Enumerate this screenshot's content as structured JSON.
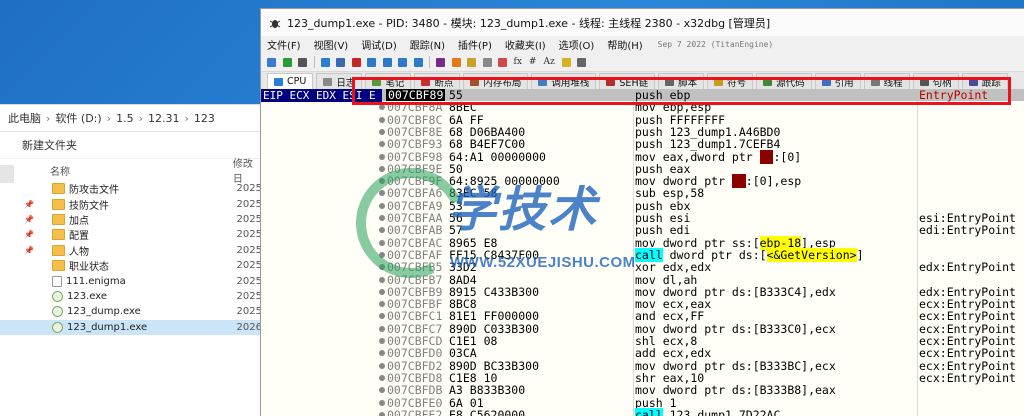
{
  "explorer": {
    "path": [
      "此电脑",
      "软件 (D:)",
      "1.5",
      "12.31",
      "123"
    ],
    "new_folder": "新建文件夹",
    "col_name": "名称",
    "col_date": "修改日",
    "items": [
      {
        "name": "防攻击文件",
        "date": "2025",
        "kind": "folder",
        "pinned": false
      },
      {
        "name": "技防文件",
        "date": "2025",
        "kind": "folder",
        "pinned": true
      },
      {
        "name": "加点",
        "date": "2025",
        "kind": "folder",
        "pinned": true
      },
      {
        "name": "配置",
        "date": "2025",
        "kind": "folder",
        "pinned": true
      },
      {
        "name": "人物",
        "date": "2025",
        "kind": "folder",
        "pinned": true
      },
      {
        "name": "职业状态",
        "date": "2025",
        "kind": "folder",
        "pinned": false
      },
      {
        "name": "111.enigma",
        "date": "2025",
        "kind": "file",
        "pinned": false
      },
      {
        "name": "123.exe",
        "date": "2025",
        "kind": "exe",
        "pinned": false
      },
      {
        "name": "123_dump.exe",
        "date": "2025",
        "kind": "exe",
        "pinned": false
      },
      {
        "name": "123_dump1.exe",
        "date": "2026",
        "kind": "exe",
        "pinned": false,
        "selected": true
      }
    ]
  },
  "dbg": {
    "title": "123_dump1.exe - PID: 3480 - 模块: 123_dump1.exe - 线程: 主线程 2380 - x32dbg [管理员]",
    "menu": [
      "文件(F)",
      "视图(V)",
      "调试(D)",
      "跟踪(N)",
      "插件(P)",
      "收藏夹(I)",
      "选项(O)",
      "帮助(H)"
    ],
    "build_info": "Sep 7 2022 (TitanEngine)",
    "toolbar_text": [
      "fx",
      "#",
      "Az"
    ],
    "tabs": [
      "CPU",
      "日志",
      "笔记",
      "断点",
      "内存布局",
      "调用堆栈",
      "SEH链",
      "脚本",
      "符号",
      "源代码",
      "引用",
      "线程",
      "句柄",
      "跟踪"
    ],
    "active_tab": "CPU",
    "regbar": "EIP ECX EDX ESI E",
    "rows": [
      {
        "addr": "007CBF89",
        "bytes": "55",
        "ins": "push ebp",
        "cmt": "EntryPoint",
        "current": true
      },
      {
        "addr": "007CBF8A",
        "bytes": "8BEC",
        "ins": "mov ebp,esp",
        "cmt": ""
      },
      {
        "addr": "007CBF8C",
        "bytes": "6A FF",
        "ins": "push FFFFFFFF",
        "cmt": ""
      },
      {
        "addr": "007CBF8E",
        "bytes": "68 D06BA400",
        "ins": "push 123_dump1.A46BD0",
        "cmt": ""
      },
      {
        "addr": "007CBF93",
        "bytes": "68 B4EF7C00",
        "ins": "push 123_dump1.7CEFB4",
        "cmt": ""
      },
      {
        "addr": "007CBF98",
        "bytes": "64:A1 00000000",
        "ins": "mov eax,dword ptr fs:[0]",
        "cmt": ""
      },
      {
        "addr": "007CBF9E",
        "bytes": "50",
        "ins": "push eax",
        "cmt": ""
      },
      {
        "addr": "007CBF9F",
        "bytes": "64:8925 00000000",
        "ins": "mov dword ptr fs:[0],esp",
        "cmt": ""
      },
      {
        "addr": "007CBFA6",
        "bytes": "83EC 58",
        "ins": "sub esp,58",
        "cmt": ""
      },
      {
        "addr": "007CBFA9",
        "bytes": "53",
        "ins": "push ebx",
        "cmt": ""
      },
      {
        "addr": "007CBFAA",
        "bytes": "56",
        "ins": "push esi",
        "cmt": "esi:EntryPoint"
      },
      {
        "addr": "007CBFAB",
        "bytes": "57",
        "ins": "push edi",
        "cmt": "edi:EntryPoint"
      },
      {
        "addr": "007CBFAC",
        "bytes": "8965 E8",
        "ins": "mov dword ptr ss:[ebp-18],esp",
        "cmt": ""
      },
      {
        "addr": "007CBFAF",
        "bytes": "FF15 C8437F00",
        "ins": "call dword ptr ds:[<&GetVersion>]",
        "cmt": ""
      },
      {
        "addr": "007CBFB5",
        "bytes": "33D2",
        "ins": "xor edx,edx",
        "cmt": "edx:EntryPoint"
      },
      {
        "addr": "007CBFB7",
        "bytes": "8AD4",
        "ins": "mov dl,ah",
        "cmt": ""
      },
      {
        "addr": "007CBFB9",
        "bytes": "8915 C433B300",
        "ins": "mov dword ptr ds:[B333C4],edx",
        "cmt": "edx:EntryPoint"
      },
      {
        "addr": "007CBFBF",
        "bytes": "8BC8",
        "ins": "mov ecx,eax",
        "cmt": "ecx:EntryPoint"
      },
      {
        "addr": "007CBFC1",
        "bytes": "81E1 FF000000",
        "ins": "and ecx,FF",
        "cmt": "ecx:EntryPoint"
      },
      {
        "addr": "007CBFC7",
        "bytes": "890D C033B300",
        "ins": "mov dword ptr ds:[B333C0],ecx",
        "cmt": "ecx:EntryPoint"
      },
      {
        "addr": "007CBFCD",
        "bytes": "C1E1 08",
        "ins": "shl ecx,8",
        "cmt": "ecx:EntryPoint"
      },
      {
        "addr": "007CBFD0",
        "bytes": "03CA",
        "ins": "add ecx,edx",
        "cmt": "ecx:EntryPoint"
      },
      {
        "addr": "007CBFD2",
        "bytes": "890D BC33B300",
        "ins": "mov dword ptr ds:[B333BC],ecx",
        "cmt": "ecx:EntryPoint"
      },
      {
        "addr": "007CBFD8",
        "bytes": "C1E8 10",
        "ins": "shr eax,10",
        "cmt": "ecx:EntryPoint"
      },
      {
        "addr": "007CBFDB",
        "bytes": "A3 B833B300",
        "ins": "mov dword ptr ds:[B333B8],eax",
        "cmt": ""
      },
      {
        "addr": "007CBFE0",
        "bytes": "6A 01",
        "ins": "push 1",
        "cmt": ""
      },
      {
        "addr": "007CBFE2",
        "bytes": "E8 C5620000",
        "ins": "call 123_dump1.7D22AC",
        "cmt": ""
      }
    ]
  },
  "watermark": {
    "big": "学技术",
    "url": "WWW.52XUEJISHU.COM"
  },
  "colors": {
    "highlight_box": "#e8131b",
    "cursor_bg": "#000000",
    "regbar_bg": "#000080",
    "seg_reg": "#8b0000",
    "call_bg": "#00ffff",
    "api_bg": "#ffff00"
  }
}
